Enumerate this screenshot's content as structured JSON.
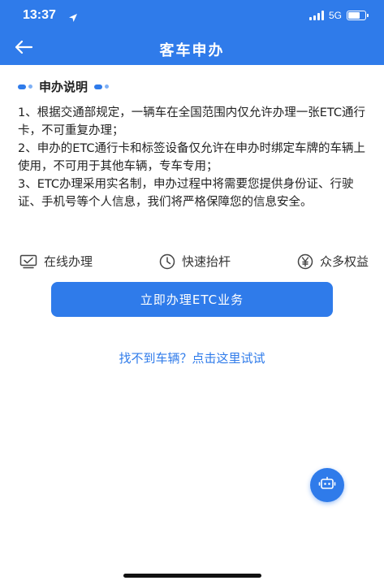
{
  "status_bar": {
    "time": "13:37",
    "network": "5G"
  },
  "nav": {
    "title": "客车申办",
    "back_icon": "arrow-left-icon"
  },
  "section": {
    "title": "申办说明"
  },
  "description": {
    "items": [
      "1、根据交通部规定，一辆车在全国范围内仅允许办理一张ETC通行卡，不可重复办理；",
      "2、申办的ETC通行卡和标签设备仅允许在申办时绑定车牌的车辆上使用，不可用于其他车辆，专车专用；",
      "3、ETC办理采用实名制，申办过程中将需要您提供身份证、行驶证、手机号等个人信息，我们将严格保障您的信息安全。"
    ]
  },
  "features": [
    {
      "label": "在线办理",
      "icon": "monitor-check-icon"
    },
    {
      "label": "快速抬杆",
      "icon": "clock-icon"
    },
    {
      "label": "众多权益",
      "icon": "yuan-icon"
    }
  ],
  "actions": {
    "primary_label": "立即办理ETC业务",
    "help_link": "找不到车辆？点击这里试试"
  },
  "colors": {
    "brand": "#2f7bea",
    "text": "#222222"
  }
}
